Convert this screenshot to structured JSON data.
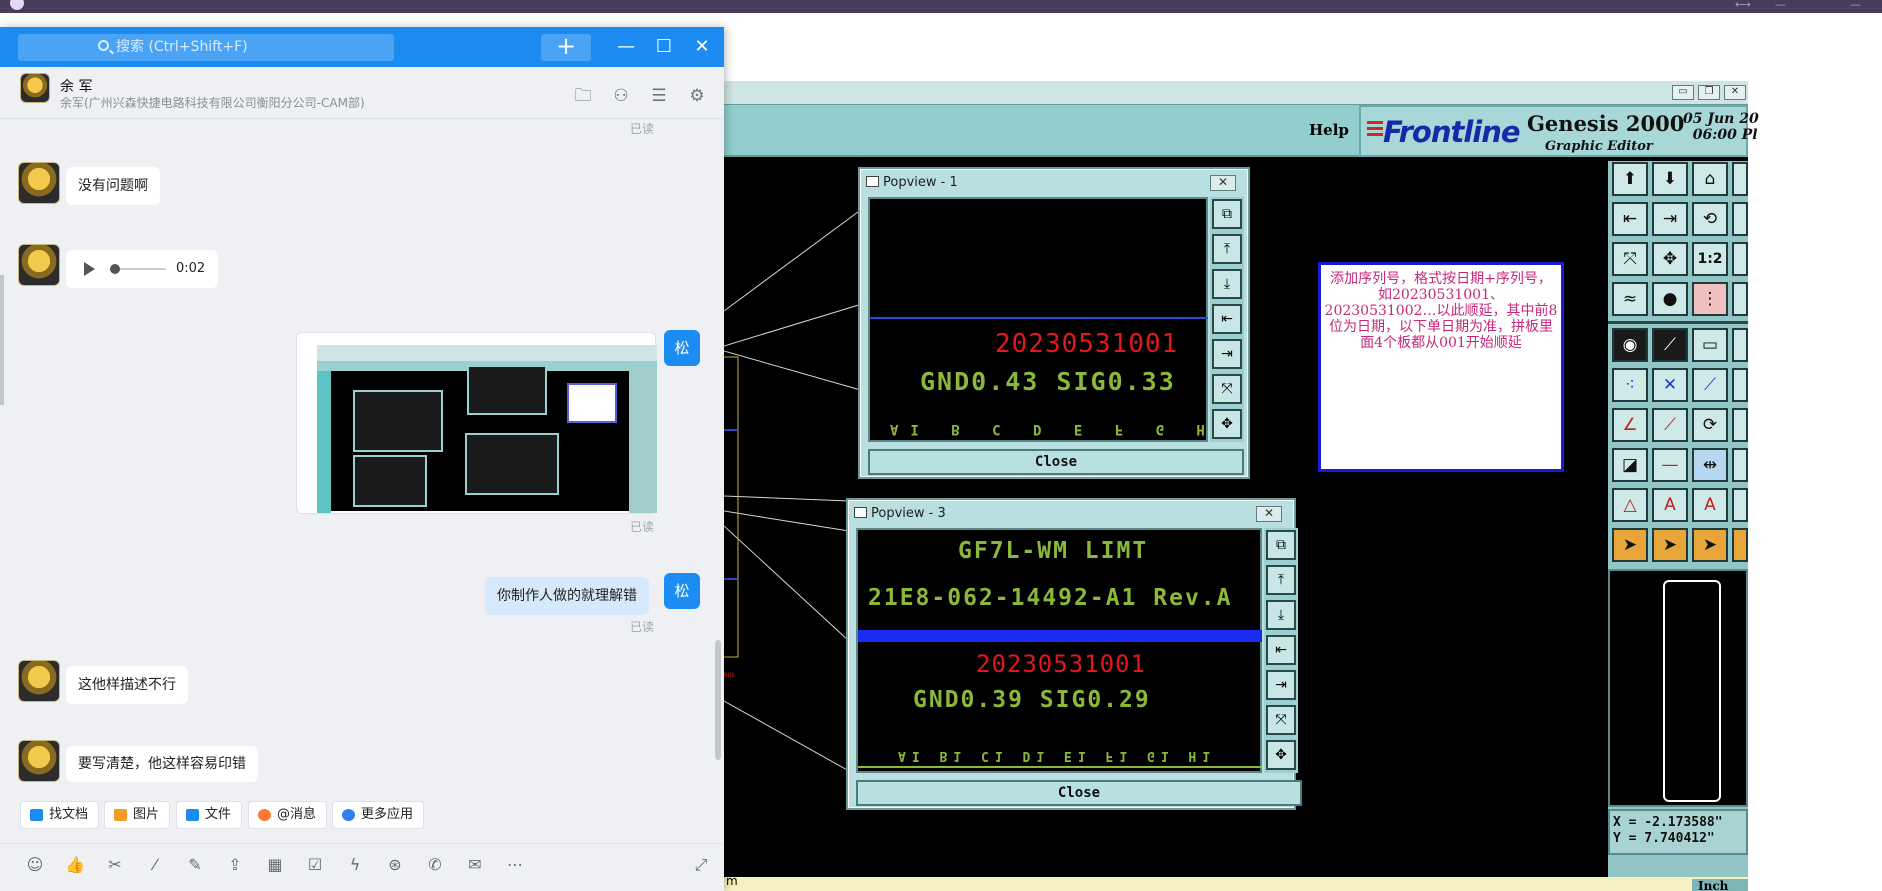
{
  "chat": {
    "search_placeholder": "搜索 (Ctrl+Shift+F)",
    "plus_label": "+",
    "window_buttons": {
      "minimize": "—",
      "maximize": "☐",
      "close": "✕"
    },
    "contact": {
      "name": "余 军",
      "org": "余军(广州兴森快捷电路科技有限公司衡阳分公司-CAM部)"
    },
    "my_avatar_text": "松",
    "read_label": "已读",
    "messages": [
      {
        "side": "left",
        "type": "text",
        "text": "没有问题啊"
      },
      {
        "side": "left",
        "type": "voice",
        "duration": "0:02"
      },
      {
        "side": "right",
        "type": "image"
      },
      {
        "side": "right",
        "type": "text",
        "text": "你制作人做的就理解错"
      },
      {
        "side": "left",
        "type": "text",
        "text": "这他样描述不行"
      },
      {
        "side": "left",
        "type": "text",
        "text": "要写清楚，他这样容易印错"
      }
    ],
    "quick_actions": [
      {
        "label": "找文档",
        "color": "#1c8cf2"
      },
      {
        "label": "图片",
        "color": "#f59a23"
      },
      {
        "label": "文件",
        "color": "#1c8cf2"
      },
      {
        "label": "@消息",
        "color": "#ff7a2e"
      },
      {
        "label": "更多应用",
        "color": "#2f80ed"
      }
    ],
    "toolbar_icons": [
      "emoji-icon",
      "thumbs-up-icon",
      "scissors-icon",
      "slash-command-icon",
      "note-icon",
      "upload-icon",
      "calendar-icon",
      "checkbox-icon",
      "lightning-icon",
      "remote-icon",
      "call-icon",
      "mail-icon",
      "more-icon",
      "expand-icon"
    ]
  },
  "genesis": {
    "help_label": "Help",
    "brand": "Frontline",
    "product": "Genesis 2000",
    "subtitle": "Graphic Editor",
    "date_line1": "05 Jun 20",
    "date_line2": "06:00 Pl",
    "popview1": {
      "title": "Popview - 1",
      "serial": "20230531001",
      "gnd_sig": "GND0.43  SIG0.33",
      "bottom": "AI B  C D  E F  G H",
      "close": "Close"
    },
    "popview3": {
      "title": "Popview - 3",
      "line1": "GF7L-WM LIMT",
      "line2": "21E8-062-14492-A1 Rev.A",
      "serial": "20230531001",
      "gnd_sig": "GND0.39  SIG0.29",
      "bottom": "AI B1  C1 D1  E1 F1  G1 H1",
      "close": "Close"
    },
    "note_text": "添加序列号，格式按日期+序列号，如20230531001、20230531002…以此顺延，其中前8位为日期，以下单日期为准，拼板里面4个板都从001开始顺延",
    "coord_x": "X = -2.173588\"",
    "coord_y": "Y = 7.740412\"",
    "status_unit": "Inch",
    "status_left": "m"
  },
  "colors": {
    "chat_blue": "#1c8cf2",
    "genesis_teal": "#92cece",
    "note_border": "#1a1ad8",
    "note_text": "#c8287a",
    "serial_red": "#e0171d",
    "text_green": "#8bb83a"
  }
}
